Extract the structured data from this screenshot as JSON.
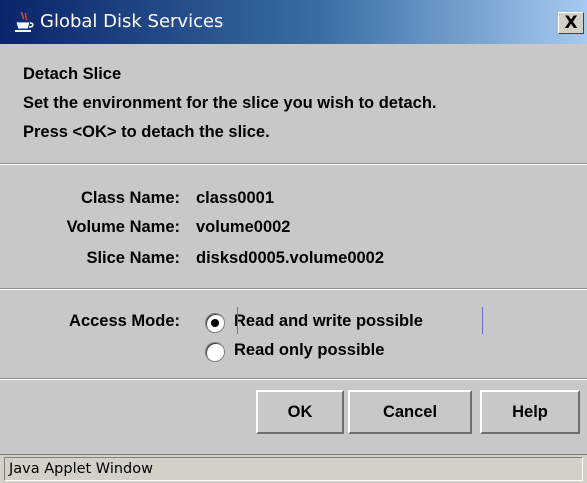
{
  "window": {
    "title": "Global Disk Services",
    "icon": "java-cup-icon",
    "close_glyph": "X"
  },
  "message": {
    "line1": "Detach Slice",
    "line2": "Set the environment for the slice you wish to detach.",
    "line3": "Press <OK> to detach the slice."
  },
  "info": {
    "class_label": "Class Name:",
    "class_value": "class0001",
    "volume_label": "Volume Name:",
    "volume_value": "volume0002",
    "slice_label": "Slice Name:",
    "slice_value": "disksd0005.volume0002"
  },
  "access_mode": {
    "label": "Access Mode:",
    "options": [
      {
        "label": "Read and write possible",
        "selected": true
      },
      {
        "label": "Read only possible",
        "selected": false
      }
    ]
  },
  "buttons": {
    "ok": "OK",
    "cancel": "Cancel",
    "help": "Help"
  },
  "status": {
    "text": "Java Applet Window"
  }
}
